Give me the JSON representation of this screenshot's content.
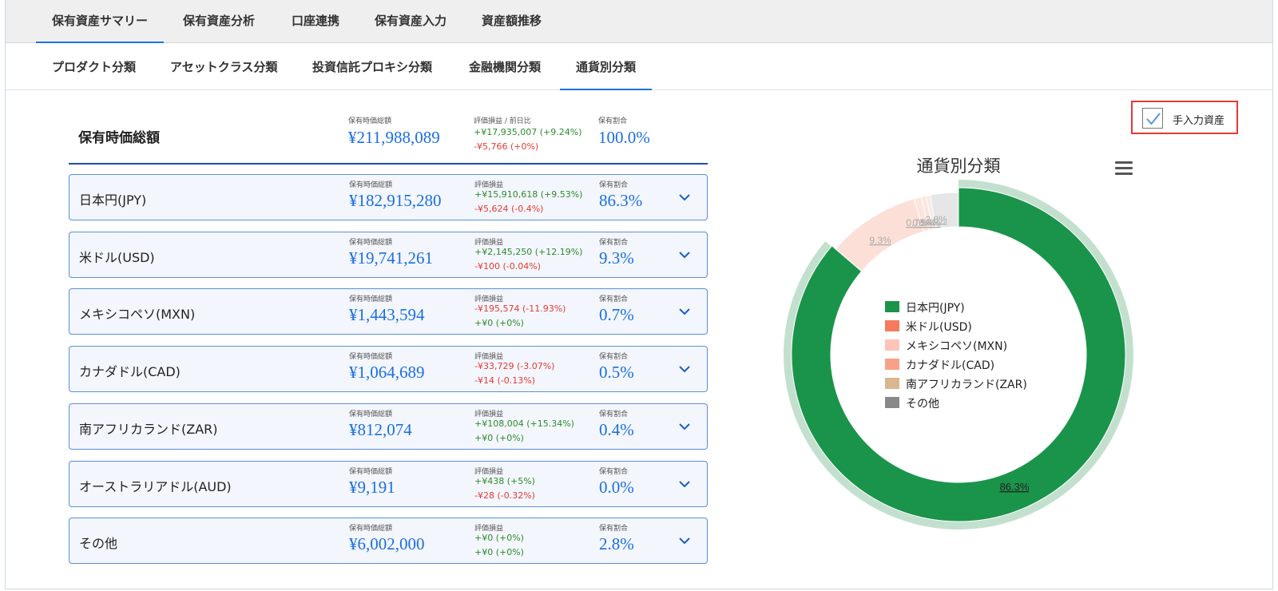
{
  "top_tabs": [
    "保有資産サマリー",
    "保有資産分析",
    "口座連携",
    "保有資産入力",
    "資産額推移"
  ],
  "sub_tabs": [
    "プロダクト分類",
    "アセットクラス分類",
    "投資信託プロキシ分類",
    "金融機関分類",
    "通貨別分類"
  ],
  "summary": {
    "title": "保有時価総額",
    "value_label": "保有時価総額",
    "value": "¥211,988,089",
    "pl_label": "評価損益 / 前日比",
    "pl": "+¥17,935,007 (+9.24%)",
    "day_change": "-¥5,766 (+0%)",
    "share_label": "保有割合",
    "share": "100.0%"
  },
  "row_labels": {
    "value": "保有時価総額",
    "pl": "評価損益",
    "share": "保有割合"
  },
  "rows": [
    {
      "name": "日本円(JPY)",
      "value": "¥182,915,280",
      "pl": "+¥15,910,618 (+9.53%)",
      "pl_type": "gain",
      "day": "-¥5,624 (-0.4%)",
      "day_type": "loss",
      "share": "86.3%"
    },
    {
      "name": "米ドル(USD)",
      "value": "¥19,741,261",
      "pl": "+¥2,145,250 (+12.19%)",
      "pl_type": "gain",
      "day": "-¥100 (-0.04%)",
      "day_type": "loss",
      "share": "9.3%"
    },
    {
      "name": "メキシコペソ(MXN)",
      "value": "¥1,443,594",
      "pl": "-¥195,574 (-11.93%)",
      "pl_type": "loss",
      "day": "+¥0 (+0%)",
      "day_type": "gain",
      "share": "0.7%"
    },
    {
      "name": "カナダドル(CAD)",
      "value": "¥1,064,689",
      "pl": "-¥33,729 (-3.07%)",
      "pl_type": "loss",
      "day": "-¥14 (-0.13%)",
      "day_type": "loss",
      "share": "0.5%"
    },
    {
      "name": "南アフリカランド(ZAR)",
      "value": "¥812,074",
      "pl": "+¥108,004 (+15.34%)",
      "pl_type": "gain",
      "day": "+¥0 (+0%)",
      "day_type": "gain",
      "share": "0.4%"
    },
    {
      "name": "オーストラリアドル(AUD)",
      "value": "¥9,191",
      "pl": "+¥438 (+5%)",
      "pl_type": "gain",
      "day": "-¥28 (-0.32%)",
      "day_type": "loss",
      "share": "0.0%"
    },
    {
      "name": "その他",
      "value": "¥6,002,000",
      "pl": "+¥0 (+0%)",
      "pl_type": "gain",
      "day": "+¥0 (+0%)",
      "day_type": "gain",
      "share": "2.8%"
    }
  ],
  "manual_checkbox": {
    "label": "手入力資産",
    "checked": true
  },
  "colors": {
    "accent": "#1a73e8",
    "value_blue": "#1a6fe0",
    "gain": "#2e8b2e",
    "loss": "#e53935"
  },
  "icons": {
    "row_toggle": "chevron-down-icon",
    "chart_menu": "hamburger-menu-icon",
    "checkbox": "check-icon"
  },
  "chart_data": {
    "type": "pie",
    "title": "通貨別分類",
    "donut": true,
    "legend_position": "center",
    "series": [
      {
        "name": "日本円(JPY)",
        "value": 86.3,
        "color": "#1a944a",
        "label": "86.3%"
      },
      {
        "name": "米ドル(USD)",
        "value": 9.3,
        "color": "#fce0d8",
        "label": "9.3%"
      },
      {
        "name": "メキシコペソ(MXN)",
        "value": 0.7,
        "color": "#fde4dc",
        "label": "0.7%"
      },
      {
        "name": "カナダドル(CAD)",
        "value": 0.5,
        "color": "#fbe6df",
        "label": "0.5%"
      },
      {
        "name": "南アフリカランド(ZAR)",
        "value": 0.4,
        "color": "#f3ece2",
        "label": "0.4%"
      },
      {
        "name": "その他",
        "value": 2.8,
        "color": "#e6e6e6",
        "label": "2.8%"
      }
    ],
    "legend": [
      {
        "name": "日本円(JPY)",
        "color": "#1a944a"
      },
      {
        "name": "米ドル(USD)",
        "color": "#f47b5c"
      },
      {
        "name": "メキシコペソ(MXN)",
        "color": "#fcc5b8"
      },
      {
        "name": "カナダドル(CAD)",
        "color": "#f8a187"
      },
      {
        "name": "南アフリカランド(ZAR)",
        "color": "#d9b78f"
      },
      {
        "name": "その他",
        "color": "#888888"
      }
    ]
  }
}
